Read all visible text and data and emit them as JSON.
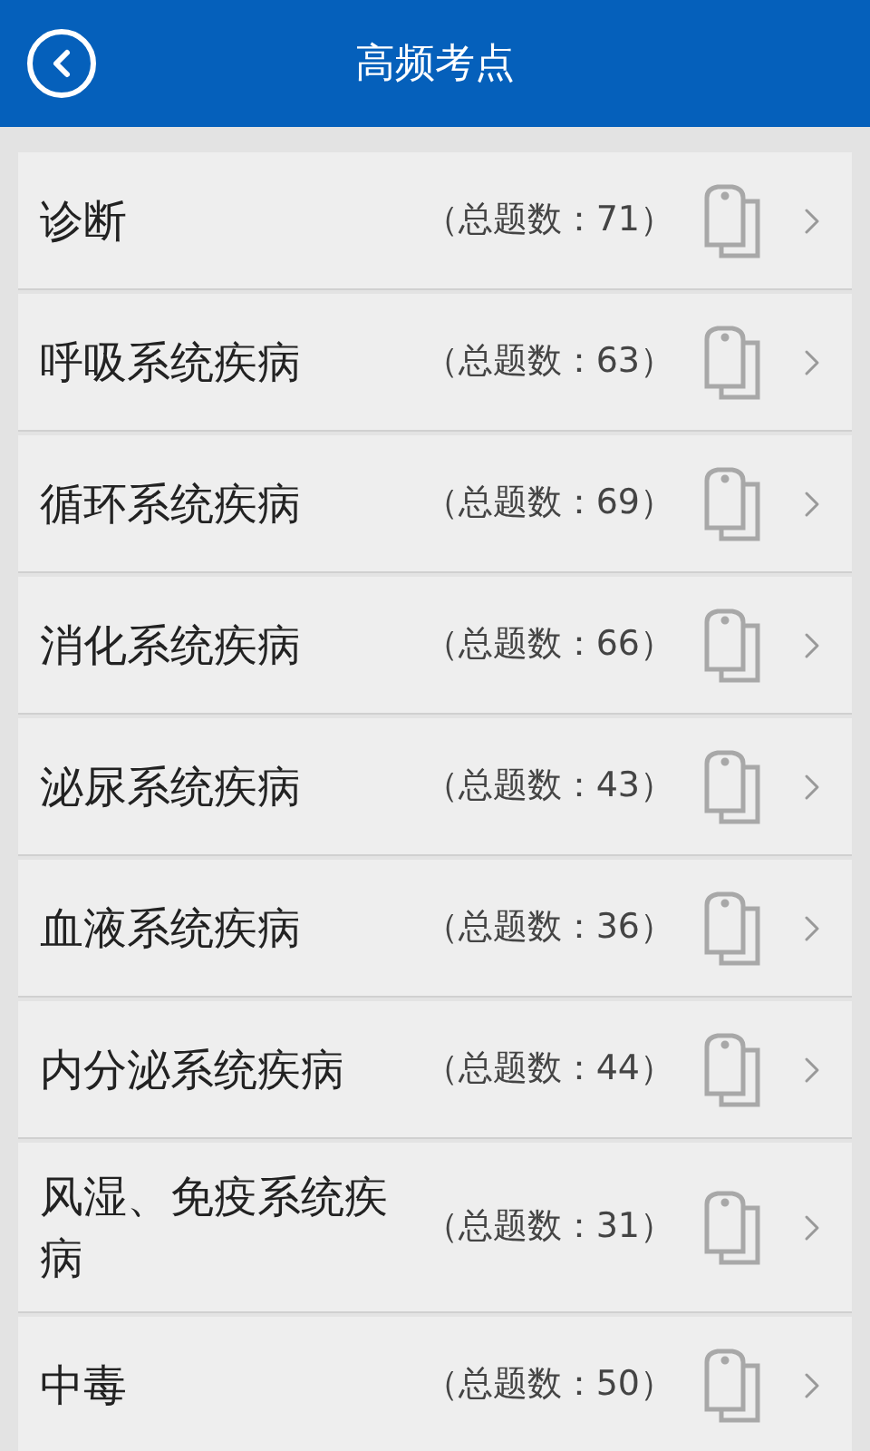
{
  "header": {
    "title": "高频考点"
  },
  "items": [
    {
      "name": "诊断",
      "count": "（总题数：71）"
    },
    {
      "name": "呼吸系统疾病",
      "count": "（总题数：63）"
    },
    {
      "name": "循环系统疾病",
      "count": "（总题数：69）"
    },
    {
      "name": "消化系统疾病",
      "count": "（总题数：66）"
    },
    {
      "name": "泌尿系统疾病",
      "count": "（总题数：43）"
    },
    {
      "name": "血液系统疾病",
      "count": "（总题数：36）"
    },
    {
      "name": "内分泌系统疾病",
      "count": "（总题数：44）"
    },
    {
      "name": "风湿、免疫系统疾病",
      "count": "（总题数：31）"
    },
    {
      "name": "中毒",
      "count": "（总题数：50）"
    }
  ]
}
